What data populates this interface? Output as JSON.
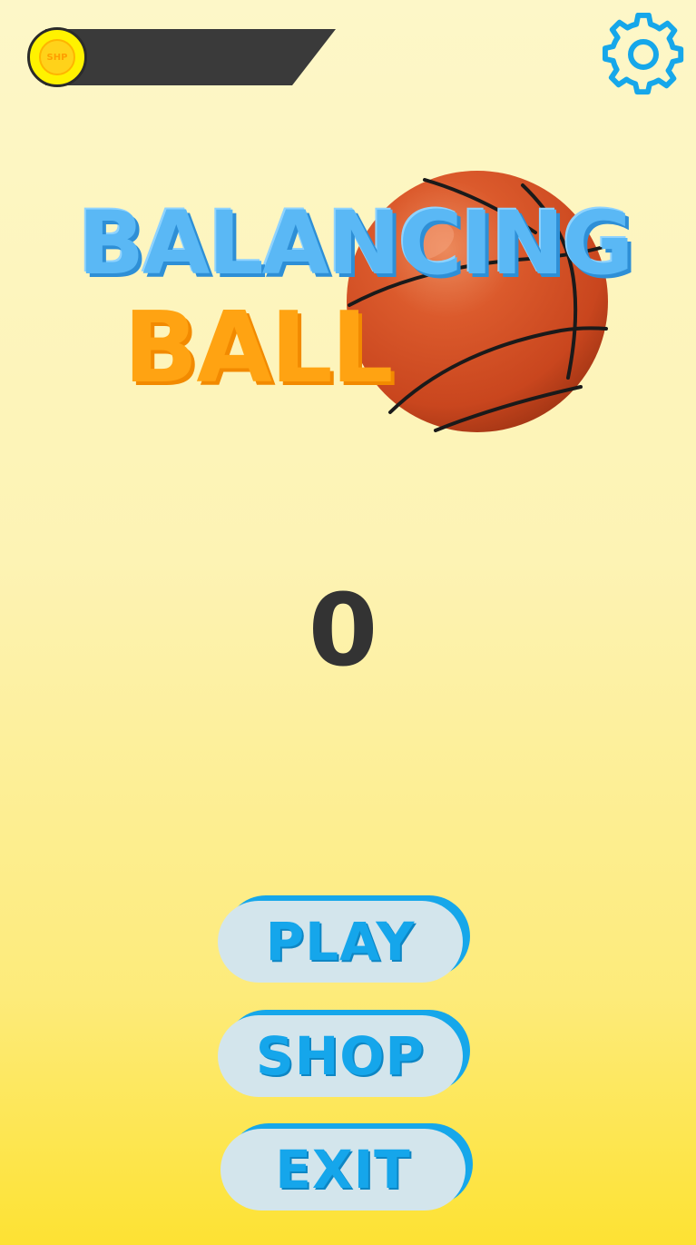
{
  "header": {
    "coin_label": "SHP",
    "coin_count": "",
    "settings_icon": "gear-icon"
  },
  "logo": {
    "title_line1": "BALANCING",
    "title_line2": "BALL",
    "ball_icon": "basketball-icon"
  },
  "score": "0",
  "menu": {
    "play_label": "PLAY",
    "shop_label": "SHOP",
    "exit_label": "EXIT"
  },
  "colors": {
    "background_top": "#fdf7c8",
    "background_bottom": "#fde233",
    "accent_blue": "#16a7ea",
    "button_face": "#d3e5ec",
    "title_orange": "#ffa312",
    "ball_orange": "#d9542a"
  }
}
